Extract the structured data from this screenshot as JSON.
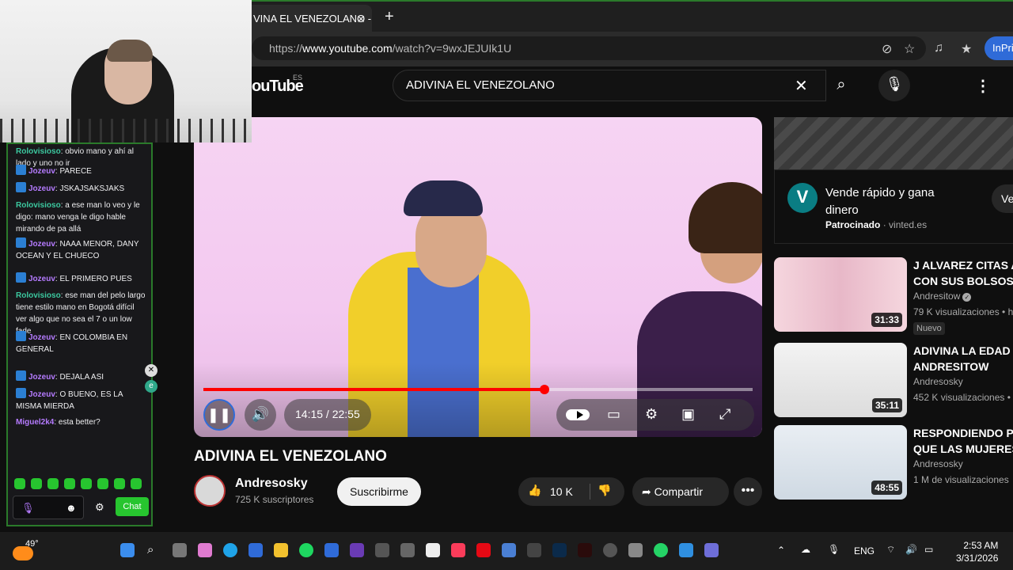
{
  "browser": {
    "tab_title": "VINA EL VENEZOLANO - Y",
    "new_tab_icon": "plus-icon",
    "url_prefix": "https://",
    "url_domain": "www.youtube.com",
    "url_path": "/watch?v=9wxJEJUIk1U",
    "inprivate_label": "InPriv"
  },
  "youtube": {
    "logo_text": "ouTube",
    "region": "ES",
    "search_value": "ADIVINA EL VENEZOLANO"
  },
  "player": {
    "time": "14:15 / 22:55",
    "progress_fraction": 0.621
  },
  "video": {
    "title": "ADIVINA EL VENEZOLANO",
    "channel": "Andresosky",
    "subscribers": "725 K suscriptores",
    "subscribe_label": "Suscribirme",
    "likes": "10 K",
    "share_label": "Compartir"
  },
  "ad": {
    "logo_letter": "V",
    "title": "Vende rápido y gana dinero",
    "sponsor_label": "Patrocinado",
    "sponsor_domain": "· vinted.es",
    "button_label": "Ve"
  },
  "recommendations": [
    {
      "title": "J ALVAREZ CITAS A",
      "title2": "CON SUS BOLSOS",
      "channel": "Andresitow",
      "views": "79 K visualizaciones • h",
      "duration": "31:33",
      "badge": "Nuevo",
      "verified": true,
      "thumb": "#f0c8d8"
    },
    {
      "title": "ADIVINA LA EDAD -",
      "title2": "ANDRESITOW",
      "channel": "Andresosky",
      "views": "452 K visualizaciones •",
      "duration": "35:11",
      "badge": "",
      "verified": false,
      "thumb": "#e7e7e7"
    },
    {
      "title": "RESPONDIENDO PR",
      "title2": "QUE LAS MUJERES",
      "channel": "Andresosky",
      "views": "1 M de visualizaciones",
      "duration": "48:55",
      "badge": "",
      "verified": false,
      "thumb": "#dfe8f0"
    }
  ],
  "chat": {
    "messages": [
      {
        "user": "Rolovisioso",
        "text": "obvio mano y ahí al lado y uno no ir",
        "badge": false
      },
      {
        "user": "Jozeuv",
        "text": "PARECE",
        "badge": true
      },
      {
        "user": "Jozeuv",
        "text": "JSKAJSAKSJAKS",
        "badge": true
      },
      {
        "user": "Rolovisioso",
        "text": "a ese man lo veo y le digo: mano venga le digo hable mirando de pa allá",
        "badge": false
      },
      {
        "user": "Jozeuv",
        "text": "NAAA MENOR, DANY OCEAN Y EL CHUECO",
        "badge": true
      },
      {
        "user": "Jozeuv",
        "text": "EL PRIMERO PUES",
        "badge": true
      },
      {
        "user": "Rolovisioso",
        "text": "ese man del pelo largo tiene estilo mano en Bogotá difícil ver algo que no sea el 7 o un low fade",
        "badge": false
      },
      {
        "user": "Jozeuv",
        "text": "EN COLOMBIA EN GENERAL",
        "badge": true
      },
      {
        "user": "Jozeuv",
        "text": "DEJALA ASI",
        "badge": true
      },
      {
        "user": "Jozeuv",
        "text": "O BUENO, ES LA MISMA MIERDA",
        "badge": true
      },
      {
        "user": "Miguel2k4",
        "text": "esta better?",
        "badge": false
      }
    ],
    "send_label": "Chat"
  },
  "taskbar": {
    "temperature": "49°",
    "language": "ENG",
    "time": "2:53 AM",
    "date": "3/31/2026"
  }
}
